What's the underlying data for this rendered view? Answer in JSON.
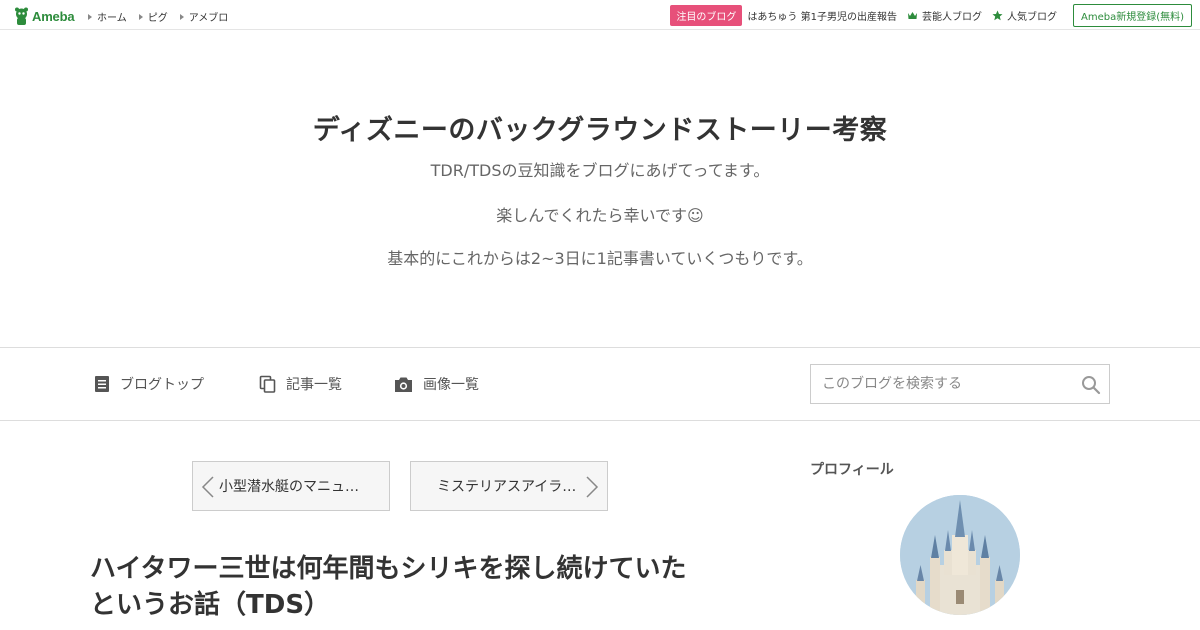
{
  "topbar": {
    "logo_text": "Ameba",
    "nav": [
      {
        "label": "ホーム"
      },
      {
        "label": "ピグ"
      },
      {
        "label": "アメブロ"
      }
    ],
    "badge": "注目のブログ",
    "pickup": "はあちゅう 第1子男児の出産報告",
    "celebrity_link": "芸能人ブログ",
    "popular_link": "人気ブログ",
    "signup": "Ameba新規登録(無料)"
  },
  "header": {
    "title": "ディズニーのバックグラウンドストーリー考察",
    "desc_1": "TDR/TDSの豆知識をブログにあげてってます。",
    "desc_2": "楽しんでくれたら幸いです☺",
    "desc_3": "基本的にこれからは2~3日に1記事書いていくつもりです。"
  },
  "navbar": {
    "blog_top": "ブログトップ",
    "articles": "記事一覧",
    "images": "画像一覧",
    "search_placeholder": "このブログを検索する"
  },
  "article": {
    "prev_title": "小型潜水艇のマニュ…",
    "next_title": "ミステリアスアイラ…",
    "title_line1": "ハイタワー三世は何年間もシリキを探し続けていた",
    "title_line2": "というお話（TDS）"
  },
  "sidebar": {
    "profile_heading": "プロフィール"
  },
  "colors": {
    "brand_green": "#2d8c3c",
    "badge_pink": "#e7507a"
  }
}
